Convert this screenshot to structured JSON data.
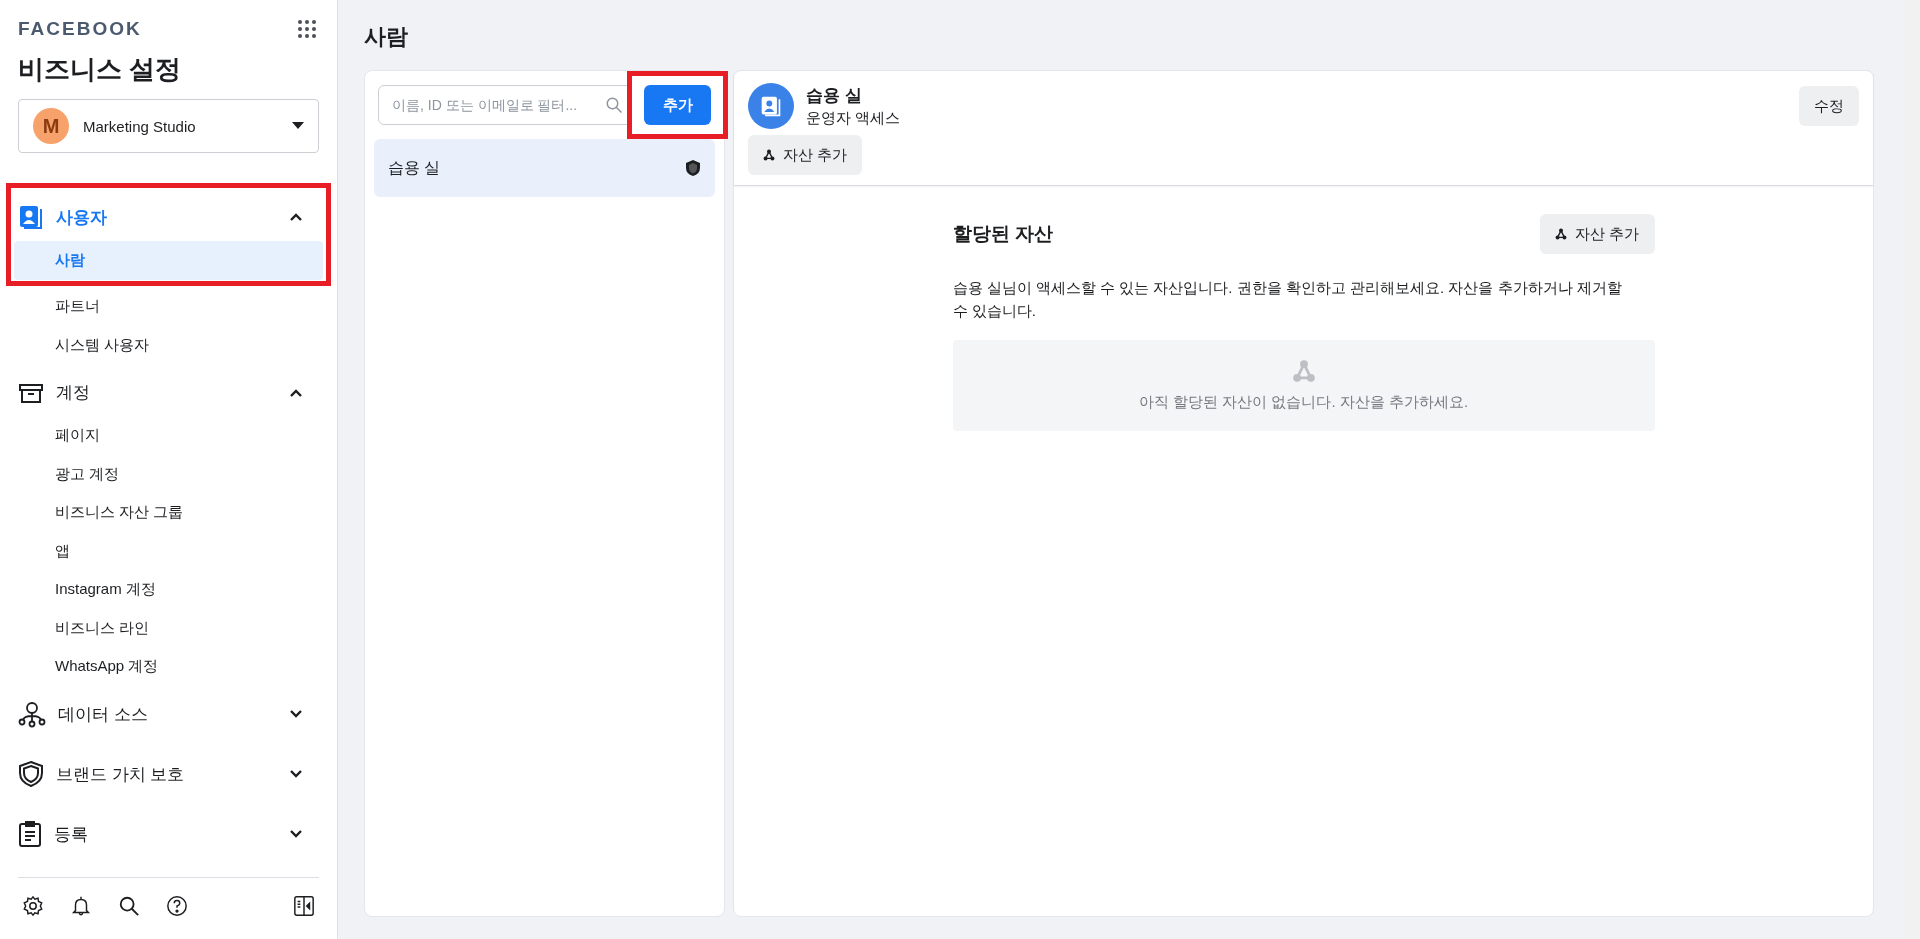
{
  "sidebar": {
    "brand": "FACEBOOK",
    "title": "비즈니스 설정",
    "account": {
      "initial": "M",
      "name": "Marketing Studio"
    },
    "sections": [
      {
        "label": "사용자",
        "kind": "users",
        "expanded": true,
        "active": true,
        "highlighted": true,
        "items": [
          {
            "label": "사람",
            "selected": true
          },
          {
            "label": "파트너",
            "selected": false
          },
          {
            "label": "시스템 사용자",
            "selected": false
          }
        ]
      },
      {
        "label": "계정",
        "kind": "accounts",
        "expanded": true,
        "active": false,
        "highlighted": false,
        "items": [
          {
            "label": "페이지",
            "selected": false
          },
          {
            "label": "광고 계정",
            "selected": false
          },
          {
            "label": "비즈니스 자산 그룹",
            "selected": false
          },
          {
            "label": "앱",
            "selected": false
          },
          {
            "label": "Instagram 계정",
            "selected": false
          },
          {
            "label": "비즈니스 라인",
            "selected": false
          },
          {
            "label": "WhatsApp 계정",
            "selected": false
          }
        ]
      },
      {
        "label": "데이터 소스",
        "kind": "data",
        "expanded": false,
        "active": false,
        "highlighted": false
      },
      {
        "label": "브랜드 가치 보호",
        "kind": "brand",
        "expanded": false,
        "active": false,
        "highlighted": false
      },
      {
        "label": "등록",
        "kind": "registration",
        "expanded": false,
        "active": false,
        "highlighted": false
      }
    ]
  },
  "page": {
    "title": "사람"
  },
  "people_list": {
    "search": {
      "placeholder": "이름, ID 또는 이메일로 필터..."
    },
    "add_button": {
      "label": "추가",
      "highlighted": true
    },
    "rows": [
      {
        "name": "습용 실",
        "selected": true
      }
    ]
  },
  "detail": {
    "name": "습용 실",
    "role": "운영자 액세스",
    "edit_button": "수정",
    "add_asset_button": "자산 추가",
    "assets": {
      "title": "할당된 자산",
      "add_button": "자산 추가",
      "description": "습용 실님이 액세스할 수 있는 자산입니다. 권한을 확인하고 관리해보세요. 자산을 추가하거나 제거할 수 있습니다.",
      "empty": "아직 할당된 자산이 없습니다. 자산을 추가하세요."
    }
  }
}
